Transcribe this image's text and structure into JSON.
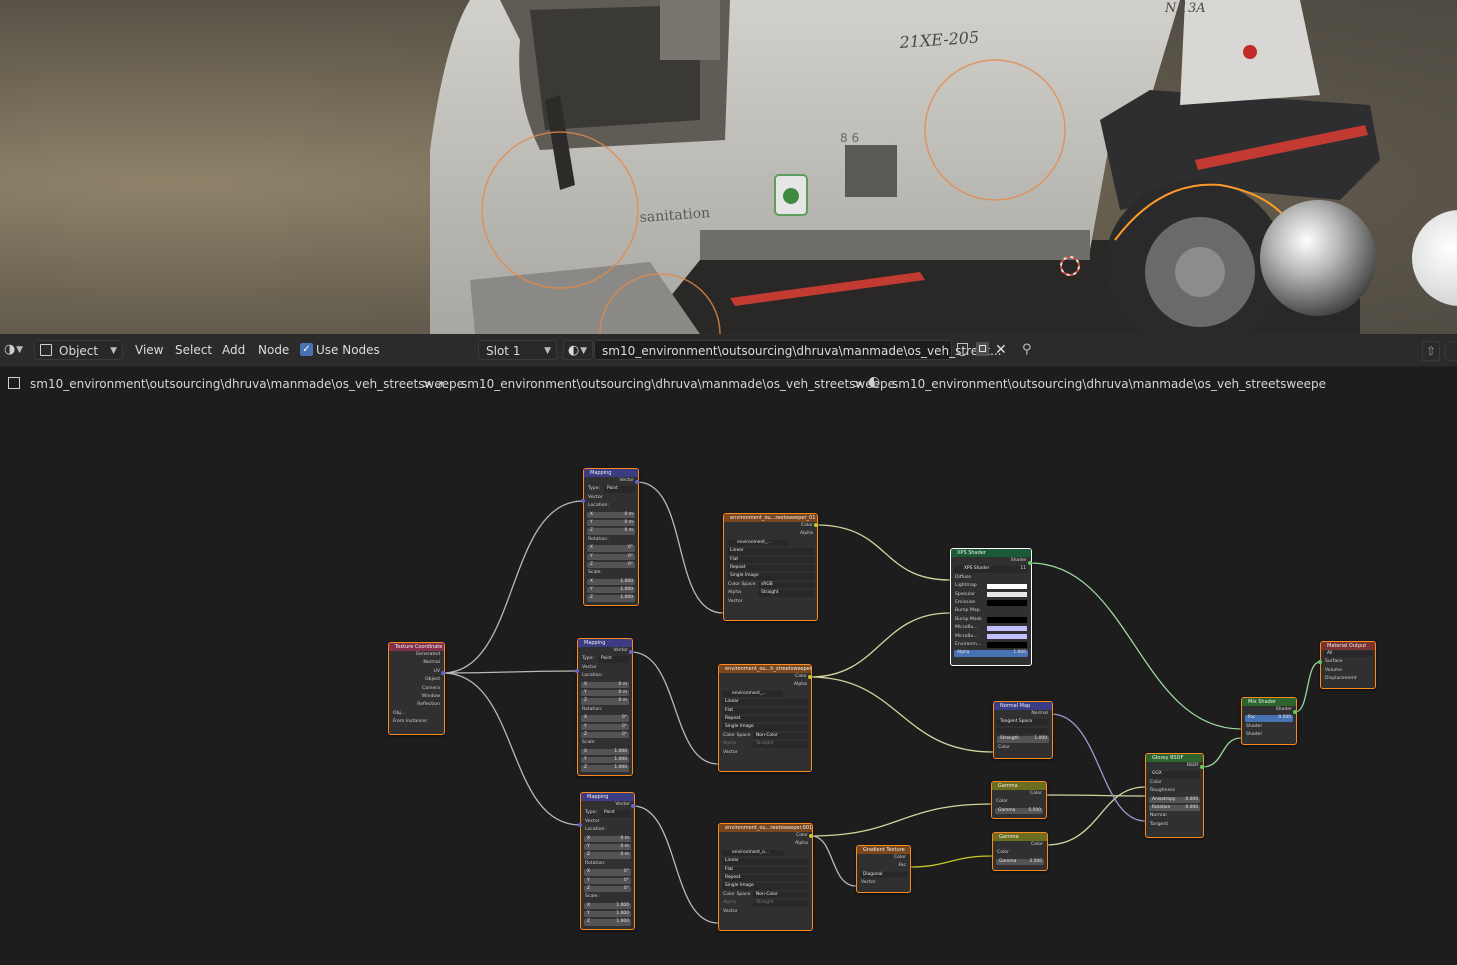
{
  "viewport": {
    "truck_labels": {
      "number": "21XE-205",
      "body": "sanitation",
      "corner": "N.13A",
      "plate": "8 6"
    }
  },
  "header": {
    "editor_type_icon": "node-editor-icon",
    "mode": "Object",
    "menus": [
      "View",
      "Select",
      "Add",
      "Node"
    ],
    "use_nodes_label": "Use Nodes",
    "use_nodes_checked": true,
    "slot": "Slot 1",
    "material_name": "sm10_environment\\outsourcing\\dhruva\\manmade\\os_veh_street...",
    "icons": [
      "shield-icon",
      "duplicate-icon",
      "close-icon",
      "pin-icon",
      "upload-icon"
    ]
  },
  "breadcrumb": {
    "items": [
      {
        "icon": "object-icon",
        "text": "sm10_environment\\outsourcing\\dhruva\\manmade\\os_veh_streetsweepe"
      },
      {
        "icon": "mesh-icon",
        "text": "sm10_environment\\outsourcing\\dhruva\\manmade\\os_veh_streetsweepe"
      },
      {
        "icon": "material-icon",
        "text": "sm10_environment\\outsourcing\\dhruva\\manmade\\os_veh_streetsweepe"
      }
    ],
    "separator": ">"
  },
  "nodes": {
    "texcoord": {
      "title": "Texture Coordinate",
      "outputs": [
        "Generated",
        "Normal",
        "UV",
        "Object",
        "Camera",
        "Window",
        "Reflection"
      ],
      "object_label": "Obj...",
      "from_instancer": "From Instancer"
    },
    "mapping1": {
      "title": "Mapping",
      "out": "Vector",
      "type_label": "Type:",
      "type_value": "Point",
      "in": "Vector",
      "location": "Location:",
      "rotation": "Rotation:",
      "scale": "Scale:",
      "loc": [
        [
          "X",
          "0 m"
        ],
        [
          "Y",
          "0 m"
        ],
        [
          "Z",
          "0 m"
        ]
      ],
      "rot": [
        [
          "X",
          "0°"
        ],
        [
          "Y",
          "0°"
        ],
        [
          "Z",
          "0°"
        ]
      ],
      "scl": [
        [
          "X",
          "1.000"
        ],
        [
          "Y",
          "1.000"
        ],
        [
          "Z",
          "1.000"
        ]
      ]
    },
    "mapping2": {
      "title": "Mapping",
      "out": "Vector",
      "type_label": "Type:",
      "type_value": "Point",
      "in": "Vector",
      "location": "Location:",
      "rotation": "Rotation:",
      "scale": "Scale:",
      "loc": [
        [
          "X",
          "0 m"
        ],
        [
          "Y",
          "0 m"
        ],
        [
          "Z",
          "0 m"
        ]
      ],
      "rot": [
        [
          "X",
          "0°"
        ],
        [
          "Y",
          "0°"
        ],
        [
          "Z",
          "0°"
        ]
      ],
      "scl": [
        [
          "X",
          "1.000"
        ],
        [
          "Y",
          "1.000"
        ],
        [
          "Z",
          "1.000"
        ]
      ]
    },
    "mapping3": {
      "title": "Mapping",
      "out": "Vector",
      "type_label": "Type:",
      "type_value": "Point",
      "in": "Vector",
      "location": "Location:",
      "rotation": "Rotation:",
      "scale": "Scale:",
      "loc": [
        [
          "X",
          "0 m"
        ],
        [
          "Y",
          "0 m"
        ],
        [
          "Z",
          "0 m"
        ]
      ],
      "rot": [
        [
          "X",
          "0°"
        ],
        [
          "Y",
          "0°"
        ],
        [
          "Z",
          "0°"
        ]
      ],
      "scl": [
        [
          "X",
          "1.000"
        ],
        [
          "Y",
          "1.000"
        ],
        [
          "Z",
          "1.000"
        ]
      ]
    },
    "imgtex1": {
      "title": "environment_ou...reetsweeper_01",
      "out_color": "Color",
      "out_alpha": "Alpha",
      "image": "environment_...",
      "interp": "Linear",
      "proj": "Flat",
      "ext": "Repeat",
      "src": "Single Image",
      "cs_label": "Color Space",
      "cs_value": "sRGB",
      "alpha_label": "Alpha",
      "alpha_value": "Straight",
      "in": "Vector"
    },
    "imgtex2": {
      "title": "environment_ou...h_streetsweeper",
      "out_color": "Color",
      "out_alpha": "Alpha",
      "image": "environment_...",
      "interp": "Linear",
      "proj": "Flat",
      "ext": "Repeat",
      "src": "Single Image",
      "cs_label": "Color Space",
      "cs_value": "Non-Color",
      "alpha_label": "Alpha",
      "alpha_value": "Straight",
      "in": "Vector"
    },
    "imgtex3": {
      "title": "environment_ou...reetsweeper.001",
      "out_color": "Color",
      "out_alpha": "Alpha",
      "image": "environment_o...",
      "interp": "Linear",
      "proj": "Flat",
      "ext": "Repeat",
      "src": "Single Image",
      "cs_label": "Color Space",
      "cs_value": "Non-Color",
      "alpha_label": "Alpha",
      "alpha_value": "Straight",
      "in": "Vector"
    },
    "xps": {
      "title": "XPS Shader",
      "out": "Shader",
      "group": "XPS Shader",
      "users": "11",
      "inputs": [
        "Diffuse",
        "Lightmap",
        "Specular",
        "Emission",
        "Bump Map",
        "Bump Mask",
        "MicroBu...",
        "MicroBu...",
        "Environm..."
      ],
      "alpha_label": "Alpha",
      "alpha_value": "1.000"
    },
    "normalmap": {
      "title": "Normal Map",
      "out": "Normal",
      "space": "Tangent Space",
      "strength_label": "Strength",
      "strength_value": "1.000",
      "in": "Color"
    },
    "gamma1": {
      "title": "Gamma",
      "out": "Color",
      "in": "Color",
      "label": "Gamma",
      "value": "5.500"
    },
    "gamma2": {
      "title": "Gamma",
      "out": "Color",
      "in": "Color",
      "label": "Gamma",
      "value": "3.500"
    },
    "gradient": {
      "title": "Gradient Texture",
      "out_color": "Color",
      "out_fac": "Fac",
      "type": "Diagonal",
      "in": "Vector"
    },
    "glossy": {
      "title": "Glossy BSDF",
      "out": "BSDF",
      "dist": "GGX",
      "color": "Color",
      "roughness": "Roughness",
      "aniso_label": "Anisotropy",
      "aniso_value": "0.000",
      "rot_label": "Rotation",
      "rot_value": "0.000",
      "normal": "Normal",
      "tangent": "Tangent"
    },
    "mix": {
      "title": "Mix Shader",
      "out": "Shader",
      "fac_label": "Fac",
      "fac_value": "0.500",
      "in1": "Shader",
      "in2": "Shader"
    },
    "output": {
      "title": "Material Output",
      "target": "All",
      "inputs": [
        "Surface",
        "Volume",
        "Displacement"
      ]
    }
  },
  "colors": {
    "header_input": "#83314a",
    "header_vector": "#3c3c83",
    "header_texture": "#79461d",
    "header_group": "#1a5a37",
    "header_shader": "#2b652b",
    "header_color": "#6d6d1f",
    "header_output": "#783232",
    "socket_yellow": "#c7c729",
    "socket_gray": "#a1a1a1",
    "socket_purple": "#6363c7",
    "socket_green": "#63c763",
    "wire": "#bdbdbd",
    "wire_color": "#d4d4a0",
    "selected": "#ff8a1e"
  }
}
